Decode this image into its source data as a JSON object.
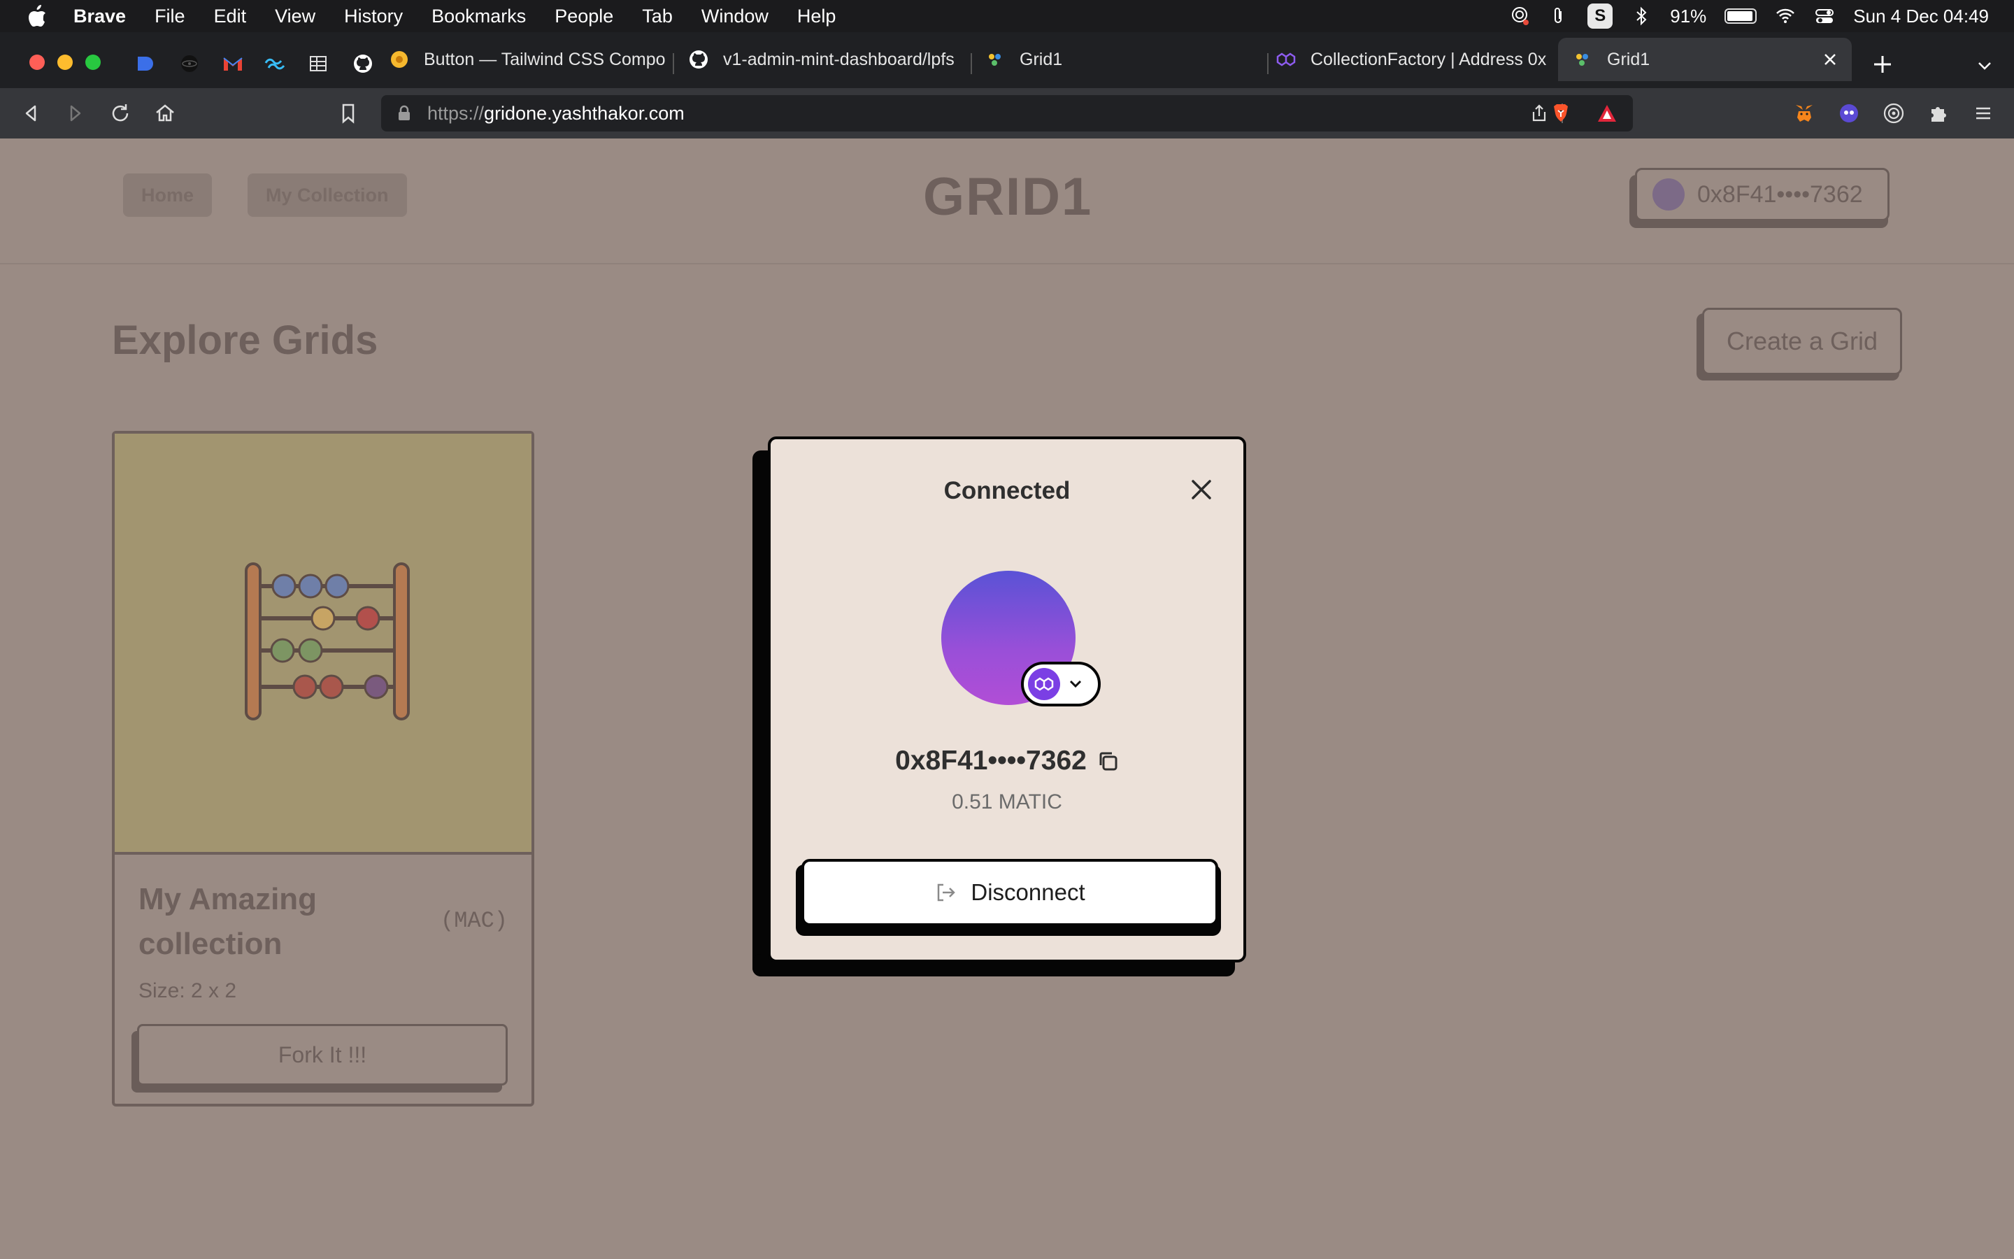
{
  "menubar": {
    "app": "Brave",
    "items": [
      "File",
      "Edit",
      "View",
      "History",
      "Bookmarks",
      "People",
      "Tab",
      "Window",
      "Help"
    ],
    "battery": "91%",
    "clock": "Sun 4 Dec  04:49",
    "s_box": "S"
  },
  "tabs": [
    {
      "title": "Button — Tailwind CSS Compo",
      "icon": "flower-icon"
    },
    {
      "title": "v1-admin-mint-dashboard/lpfs",
      "icon": "github-icon"
    },
    {
      "title": "Grid1",
      "icon": "grid1-favicon"
    },
    {
      "title": "CollectionFactory | Address 0x",
      "icon": "polygon-icon"
    },
    {
      "title": "Grid1",
      "icon": "grid1-favicon",
      "active": true
    }
  ],
  "toolbar": {
    "url_scheme": "https://",
    "url_host": "gridone.yashthakor.com"
  },
  "page": {
    "nav_home": "Home",
    "nav_collection": "My Collection",
    "brand": "GRID1",
    "wallet_address": "0x8F41••••7362",
    "heading": "Explore Grids",
    "create_button": "Create a Grid",
    "card": {
      "name": "My Amazing collection",
      "symbol": "(MAC)",
      "size": "Size: 2 x 2",
      "fork_button": "Fork It !!!"
    }
  },
  "modal": {
    "title": "Connected",
    "address": "0x8F41••••7362",
    "balance": "0.51 MATIC",
    "disconnect": "Disconnect"
  },
  "colors": {
    "overlay": "#9a8b84",
    "modal_bg": "#ece1d9",
    "avatar_top": "#5a52d6",
    "avatar_bottom": "#b14ed6",
    "polygon": "#7b3fe4"
  }
}
